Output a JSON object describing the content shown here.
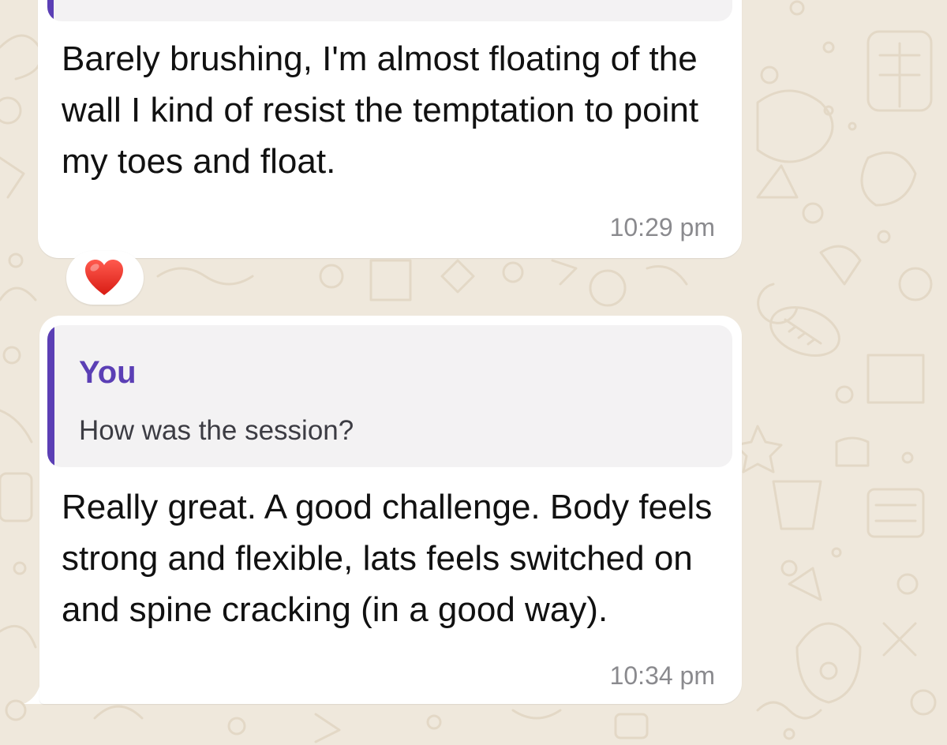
{
  "messages": [
    {
      "text": "Barely brushing, I'm almost floating of the wall I kind of resist the temptation to point my toes and float.",
      "time": "10:29 pm",
      "reaction": "heart-emoji"
    },
    {
      "quote": {
        "author": "You",
        "text": "How was the session?"
      },
      "text": "Really great. A good challenge. Body feels strong and flexible, lats feels switched on and spine cracking (in a good way).",
      "time": "10:34 pm"
    }
  ],
  "colors": {
    "wallpaper": "#efe8dc",
    "bubble": "#ffffff",
    "quote_background": "#f3f2f3",
    "quote_accent": "#5b3fb5",
    "timestamp": "#8a8a8e"
  }
}
